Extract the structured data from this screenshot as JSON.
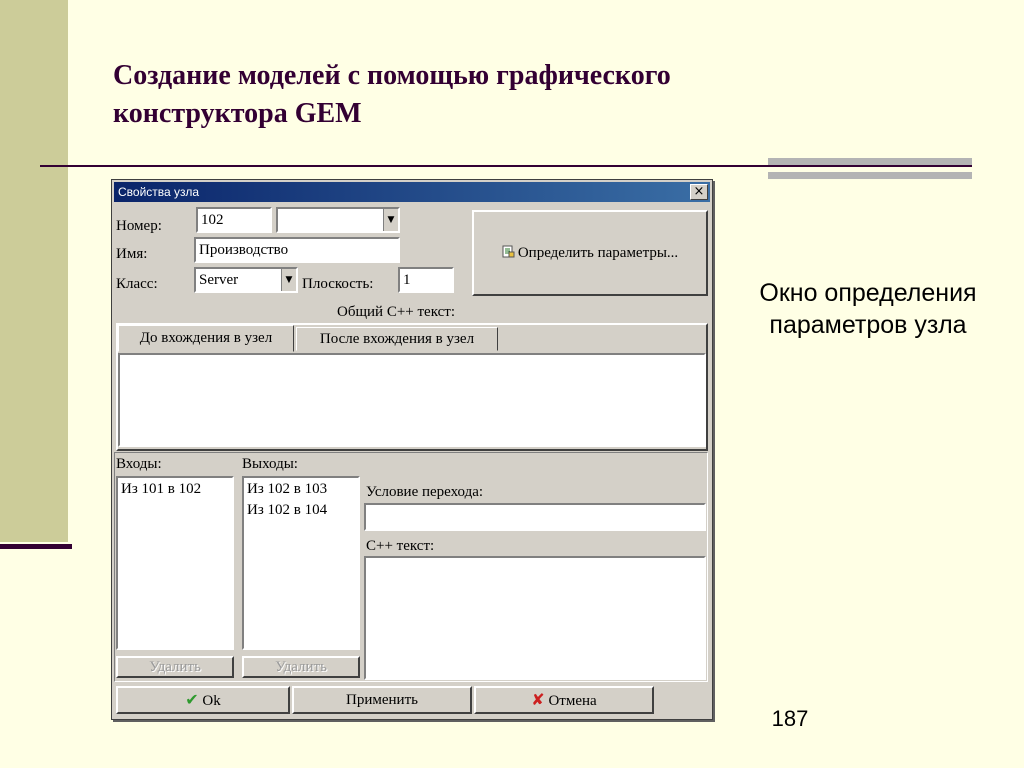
{
  "slide": {
    "title": "Создание моделей с помощью графического конструктора GEM",
    "caption": "Окно определения параметров узла",
    "page_number": "187"
  },
  "dialog": {
    "title": "Свойства узла",
    "close_symbol": "×",
    "number_label": "Номер:",
    "number_value": "102",
    "number_dropdown_value": "",
    "name_label": "Имя:",
    "name_value": "Производство",
    "class_label": "Класс:",
    "class_value": "Server",
    "plane_label": "Плоскость:",
    "plane_value": "1",
    "define_params_label": "Определить параметры...",
    "cpp_group_label": "Общий C++ текст:",
    "tabs": [
      {
        "label": "До вхождения в узел",
        "active": true
      },
      {
        "label": "После вхождения в узел",
        "active": false
      }
    ],
    "inputs_label": "Входы:",
    "inputs": [
      "Из 101 в 102"
    ],
    "outputs_label": "Выходы:",
    "outputs": [
      "Из 102 в 103",
      "Из 102 в 104"
    ],
    "transition_label": "Условие перехода:",
    "transition_value": "",
    "cpp_text_label": "C++ текст:",
    "delete_label": "Удалить",
    "ok_label": "Ok",
    "apply_label": "Применить",
    "cancel_label": "Отмена"
  },
  "icons": {
    "ok": "check-icon",
    "cancel": "x-icon",
    "define_params": "properties-icon",
    "dropdown": "dropdown-arrow-icon"
  },
  "colors": {
    "slide_background": "#FFFFE5",
    "accent_band": "#CCCC99",
    "title_color": "#330033",
    "dialog_face": "#D4D0C8",
    "titlebar_start": "#0A246A",
    "titlebar_end": "#3A6EA5"
  }
}
